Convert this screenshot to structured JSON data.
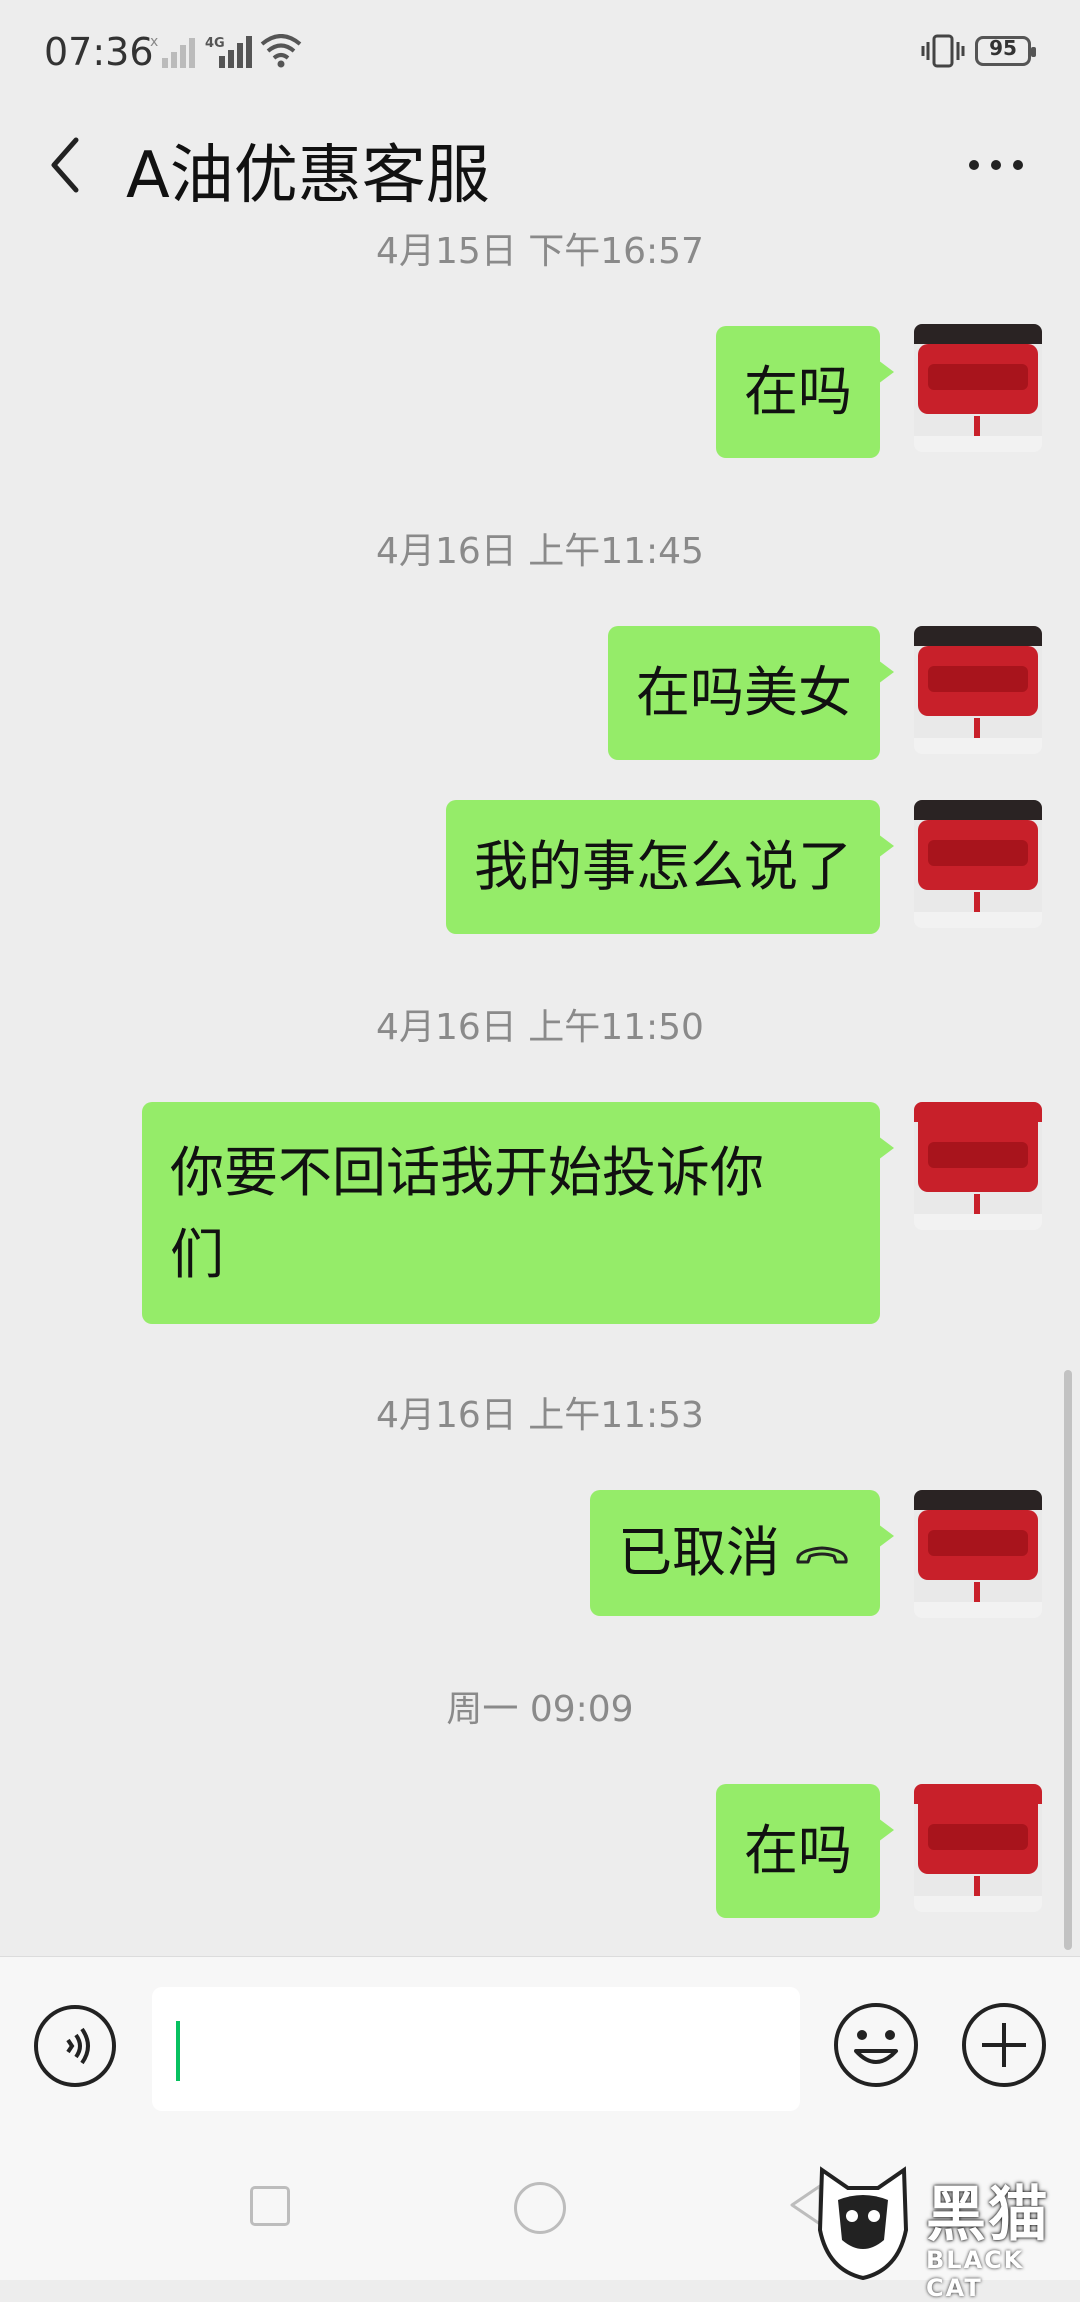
{
  "status_bar": {
    "time": "07:36",
    "battery": "95"
  },
  "header": {
    "title": "A油优惠客服"
  },
  "messages": [
    {
      "timestamp": "4月15日 下午16:57",
      "text": "在吗"
    },
    {
      "timestamp": "4月16日 上午11:45",
      "text": "在吗美女"
    },
    {
      "text": "我的事怎么说了"
    },
    {
      "timestamp": "4月16日 上午11:50",
      "text_line1": "你要不回话我开始投诉你",
      "text_line2": "们"
    },
    {
      "timestamp": "4月16日 上午11:53",
      "text": "已取消"
    },
    {
      "timestamp": "周一 09:09",
      "text": "在吗"
    }
  ],
  "input": {
    "value": ""
  },
  "watermark": {
    "cn": "黑猫",
    "en": "BLACK CAT"
  },
  "colors": {
    "bubble": "#95ec69",
    "background": "#ededed",
    "caret": "#07c160"
  }
}
